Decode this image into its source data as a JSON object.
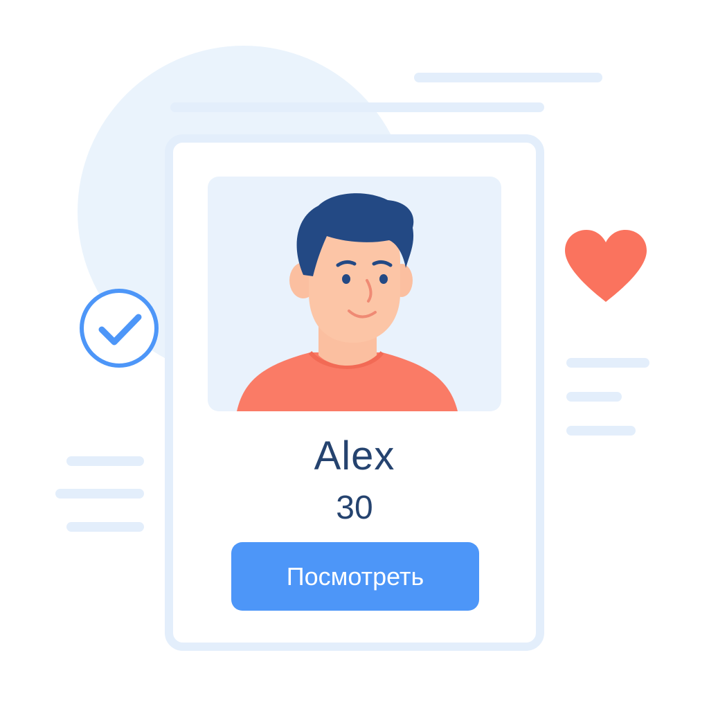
{
  "profile": {
    "name": "Alex",
    "age": "30",
    "view_button_label": "Посмотреть"
  },
  "icons": {
    "verified": "check-circle-icon",
    "favorite": "heart-icon"
  },
  "colors": {
    "accent": "#4d96f8",
    "heart": "#fa735e",
    "text": "#25436f",
    "placeholder_lines": "#e3eefb"
  }
}
